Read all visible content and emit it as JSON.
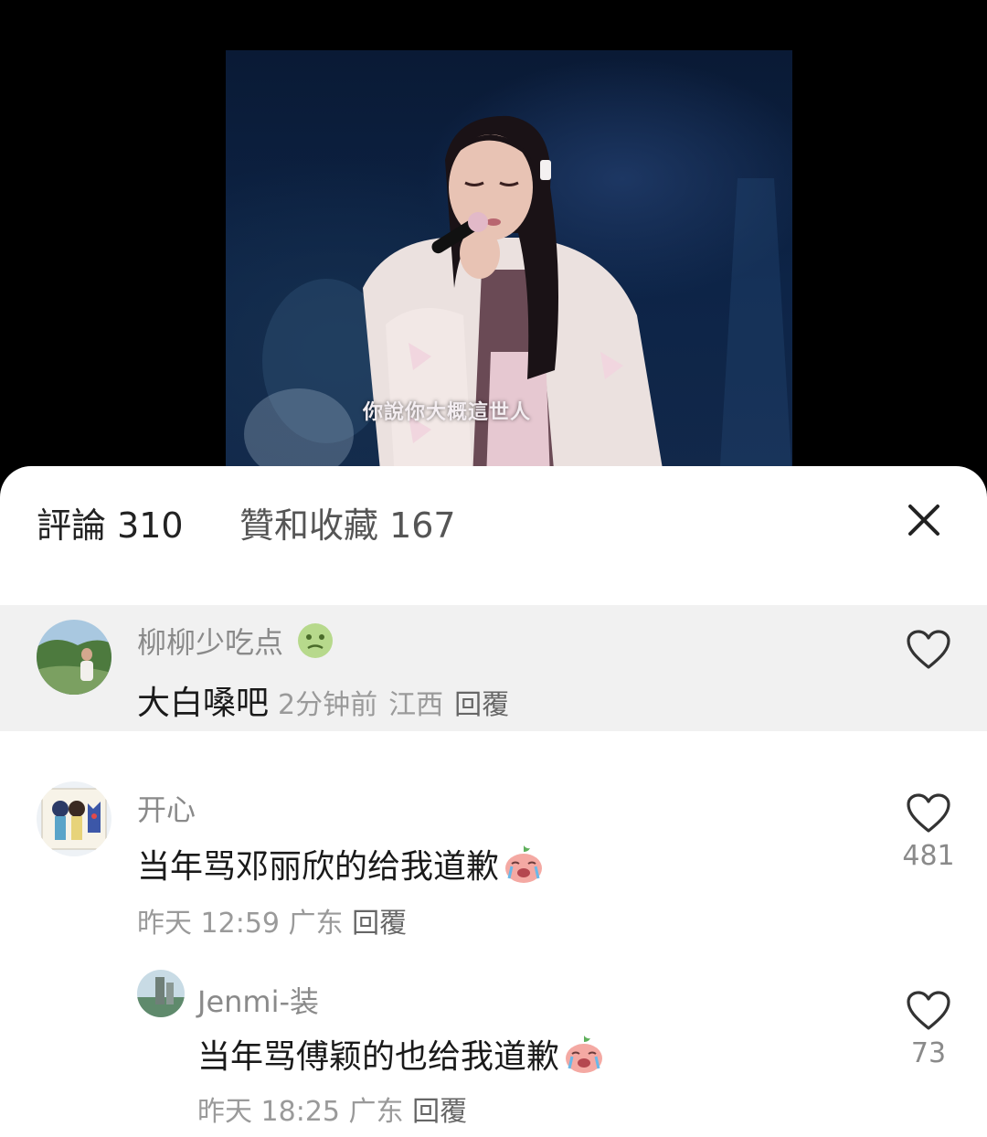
{
  "video": {
    "subtitle": "你說你大概這世人"
  },
  "tabs": {
    "comments": "評論 310",
    "likes_favorites": "贊和收藏 167"
  },
  "comments": [
    {
      "username": "柳柳少吃点",
      "text": "大白嗓吧",
      "time": "2分钟前",
      "location": "江西",
      "reply": "回覆"
    },
    {
      "username": "开心",
      "text": "当年骂邓丽欣的给我道歉",
      "time": "昨天 12:59",
      "location": "广东",
      "reply": "回覆",
      "likes": "481"
    },
    {
      "username": "Jenmi-装",
      "text": "当年骂傅颖的也给我道歉",
      "time": "昨天 18:25",
      "location": "广东",
      "reply": "回覆",
      "likes": "73"
    }
  ],
  "colors": {
    "highlight_bg": "#f1f1f1",
    "text_primary": "#1a1a1a",
    "text_secondary": "#8a8a8a"
  },
  "icons": [
    "close-icon",
    "heart-icon",
    "cry-emoji-icon",
    "sick-emoji-icon"
  ]
}
